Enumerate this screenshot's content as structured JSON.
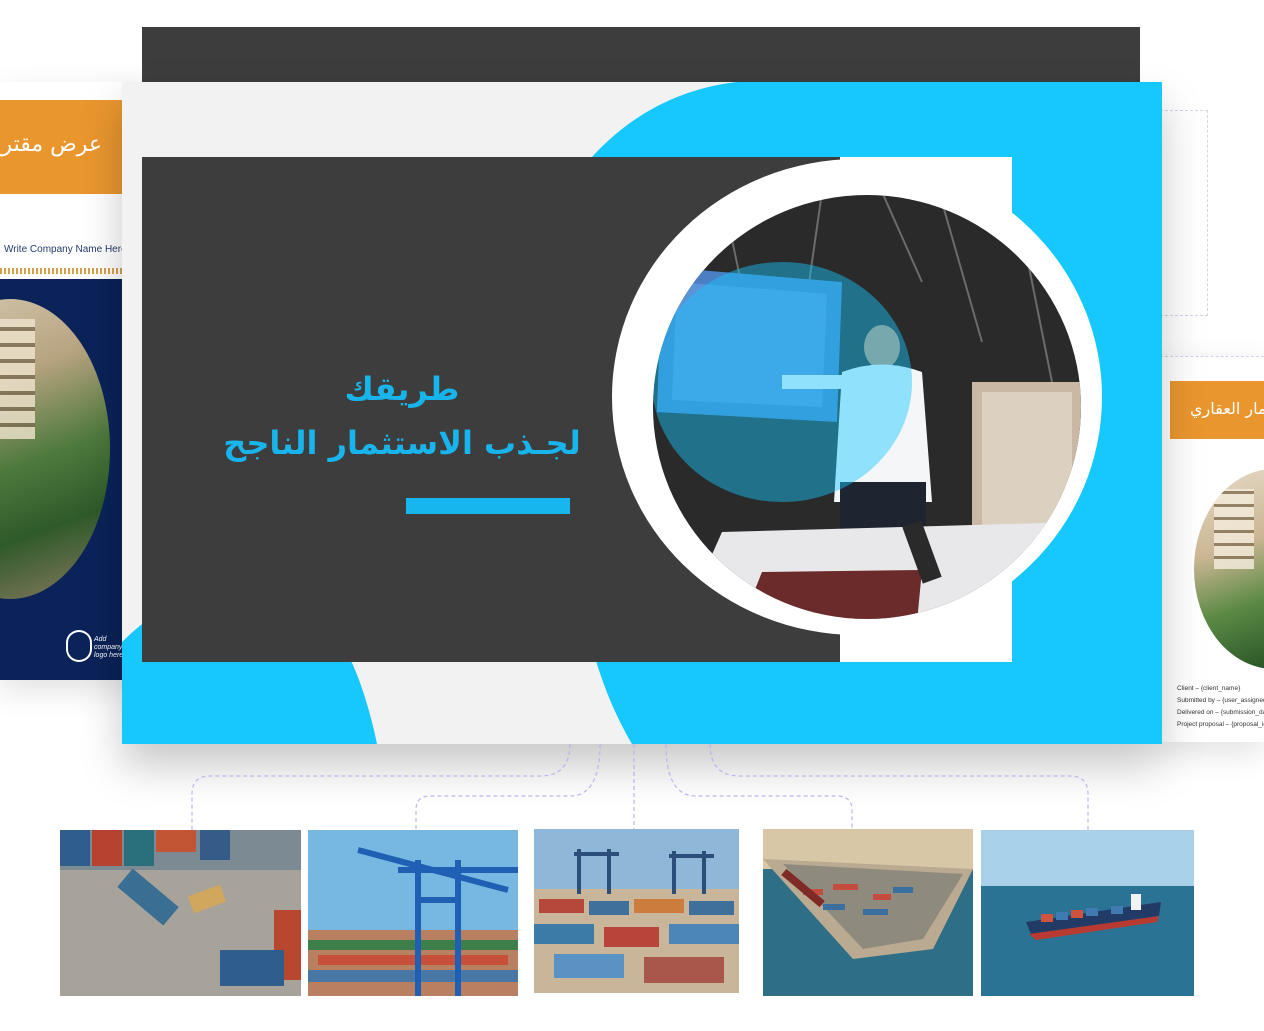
{
  "left_card": {
    "banner_text": "عرض مقترح",
    "company_name": "Write Company Name Here",
    "logo_text": "Add company logo here",
    "icon": "company-logo-icon"
  },
  "right_card": {
    "banner_text": "عرض الاستثمار العقاري",
    "meta": [
      "Client – {client_name}",
      "Submitted by – {user_assigned}",
      "Delivered on – {submission_date}",
      "Project proposal – {proposal_id}"
    ]
  },
  "main_slide": {
    "title_line1": "طريقك",
    "title_line2": "لجـذب الاستثمار الناجح"
  },
  "colors": {
    "accent_blue": "#17c8ff",
    "dark_panel": "#3d3d3d",
    "orange": "#ea962f",
    "navy": "#0b2359"
  },
  "photos": [
    "aerial-container-yard",
    "port-cranes",
    "container-terminal",
    "aerial-port",
    "container-ship"
  ]
}
